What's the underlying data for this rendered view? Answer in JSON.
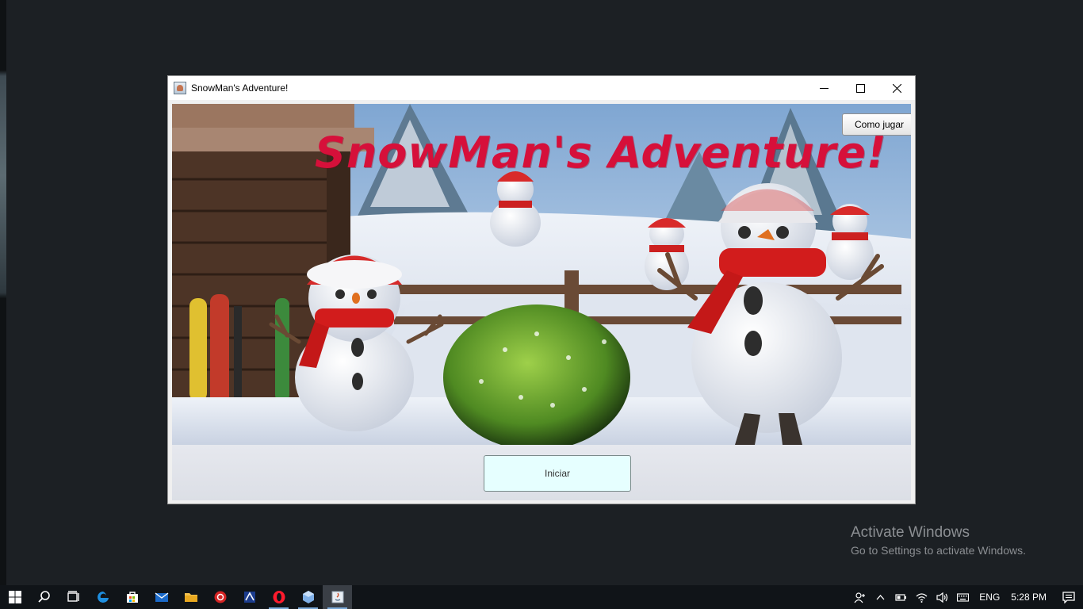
{
  "window": {
    "title": "SnowMan's Adventure!"
  },
  "game": {
    "title": "SnowMan's Adventure!",
    "how_to_play_label": "Como jugar",
    "start_label": "Iniciar"
  },
  "watermark": {
    "title": "Activate Windows",
    "subtitle": "Go to Settings to activate Windows."
  },
  "taskbar": {
    "pinned_icons": [
      "windows-start-icon",
      "search-icon",
      "task-view-icon",
      "edge-icon",
      "store-icon",
      "mail-icon",
      "file-explorer-icon",
      "app-red-icon",
      "app-blue-icon",
      "opera-icon",
      "virtualbox-icon",
      "java-icon"
    ],
    "language": "ENG",
    "time": "5:28 PM"
  },
  "colors": {
    "title_red": "#d6103a",
    "start_button_bg": "#e6ffff",
    "taskbar_bg": "#101418",
    "desktop_bg": "#1c2024"
  }
}
